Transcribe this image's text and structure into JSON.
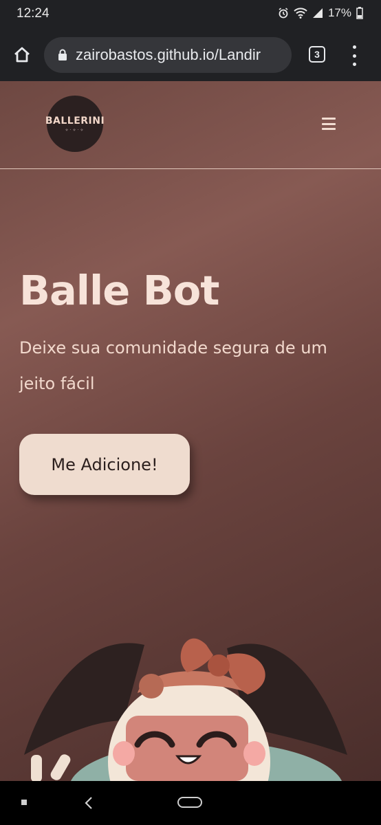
{
  "status_bar": {
    "time": "12:24",
    "battery": "17%"
  },
  "browser": {
    "url": "zairobastos.github.io/Landir",
    "tab_count": "3"
  },
  "header": {
    "logo_text": "BALLERINI"
  },
  "hero": {
    "title": "Balle Bot",
    "subtitle": "Deixe sua comunidade segura de um jeito fácil",
    "cta_label": "Me Adicione!"
  },
  "colors": {
    "accent": "#efdccf",
    "background": "#7a514b"
  }
}
